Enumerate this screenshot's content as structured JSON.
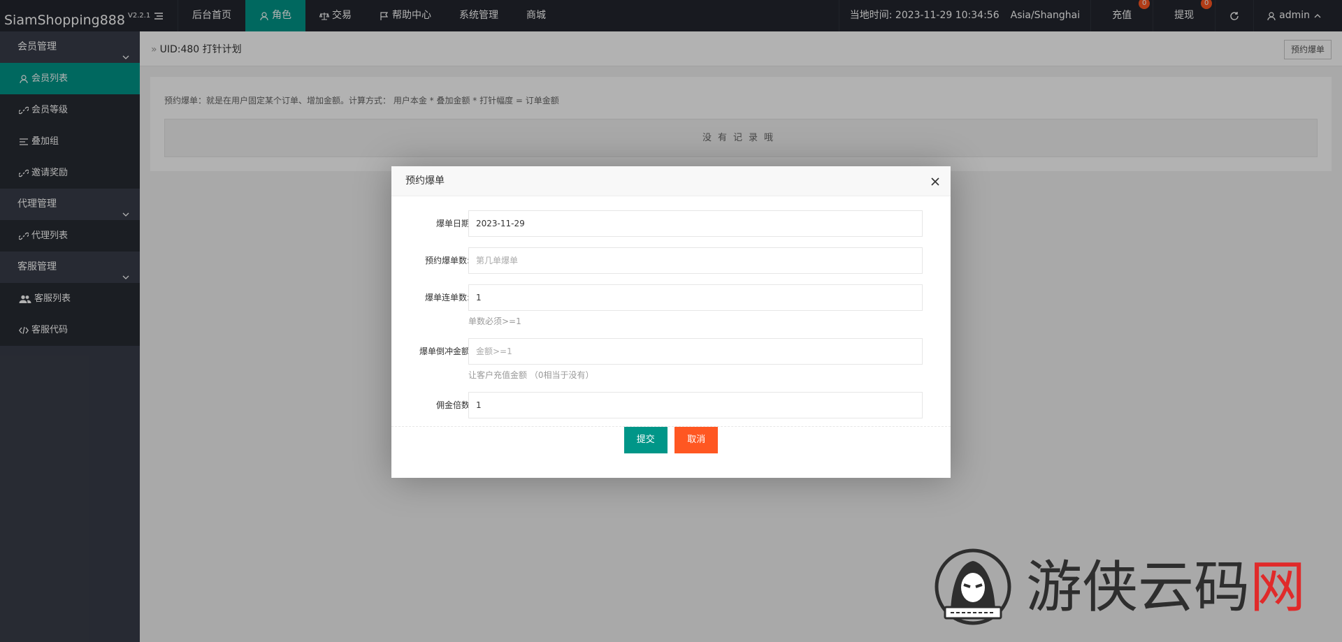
{
  "header": {
    "logo": "SiamShopping888",
    "version": "V2.2.1",
    "nav": [
      {
        "label": "后台首页"
      },
      {
        "label": "角色",
        "icon": "user-icon"
      },
      {
        "label": "交易",
        "icon": "scale-icon"
      },
      {
        "label": "帮助中心",
        "icon": "flag-icon"
      },
      {
        "label": "系统管理"
      },
      {
        "label": "商城"
      }
    ],
    "time_label": "当地时间: 2023-11-29 10:34:56",
    "timezone": "Asia/Shanghai",
    "recharge": {
      "label": "充值",
      "count": "0"
    },
    "withdraw": {
      "label": "提现",
      "count": "0"
    },
    "user": "admin"
  },
  "sidebar": {
    "groups": [
      {
        "label": "会员管理",
        "items": [
          "会员列表",
          "会员等级",
          "叠加组",
          "邀请奖励"
        ]
      },
      {
        "label": "代理管理",
        "items": [
          "代理列表"
        ]
      },
      {
        "label": "客服管理",
        "items": [
          "客服列表",
          "客服代码"
        ]
      }
    ]
  },
  "main": {
    "breadcrumb": "UID:480 打针计划",
    "top_button": "预约爆单",
    "description": "预约爆单：就是在用户固定某个订单、增加金额。计算方式： 用户本金 * 叠加金额 * 打针幅度 = 订单金额",
    "empty_text": "没有记录哦"
  },
  "modal": {
    "title": "预约爆单",
    "fields": [
      {
        "label": "爆单日期",
        "value": "2023-11-29",
        "placeholder": ""
      },
      {
        "label": "预约爆单数:",
        "value": "",
        "placeholder": "第几单爆单"
      },
      {
        "label": "爆单连单数:",
        "value": "1",
        "placeholder": "",
        "help": "单数必须>=1"
      },
      {
        "label": "爆单倒冲金额",
        "value": "",
        "placeholder": "金额>=1",
        "help": "让客户充值金额 （0相当于没有）"
      },
      {
        "label": "佣金倍数",
        "value": "1",
        "placeholder": ""
      }
    ],
    "submit": "提交",
    "cancel": "取消"
  },
  "watermark": {
    "text": "游侠云码",
    "mark": "网"
  },
  "colors": {
    "primary": "#009688",
    "danger": "#ff5722",
    "header_bg": "#23262e",
    "sidebar_bg": "#393d49"
  }
}
